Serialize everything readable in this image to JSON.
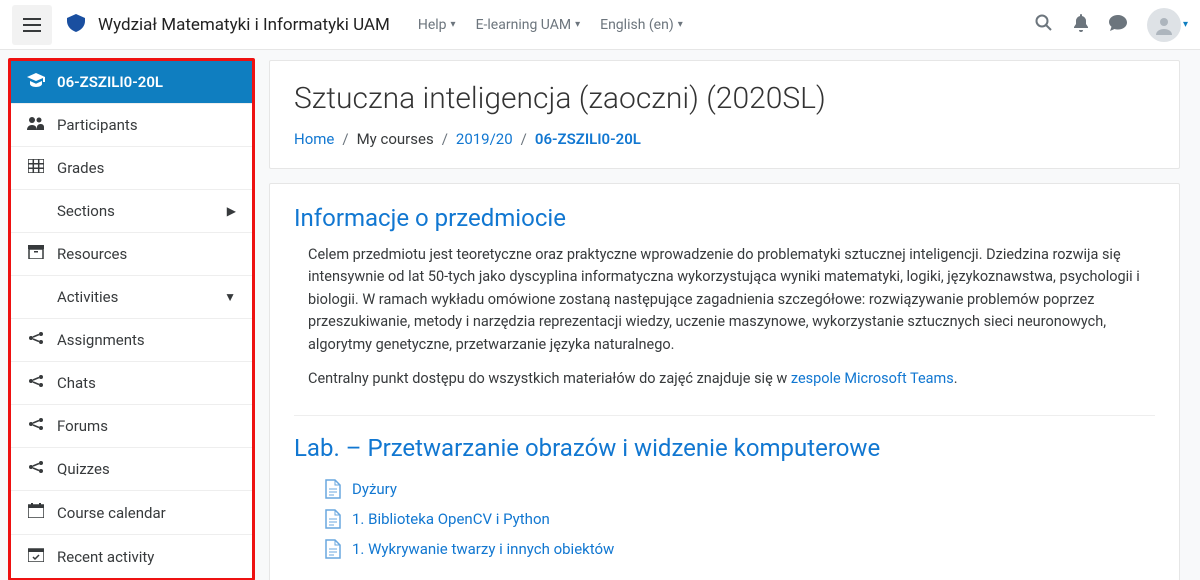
{
  "header": {
    "brand": "Wydział Matematyki i Informatyki UAM",
    "nav": [
      {
        "label": "Help"
      },
      {
        "label": "E-learning UAM"
      },
      {
        "label": "English (en)"
      }
    ]
  },
  "sidebar": {
    "items": [
      {
        "label": "06-ZSZILI0-20L",
        "icon": "graduation-cap-icon",
        "active": true
      },
      {
        "label": "Participants",
        "icon": "users-icon"
      },
      {
        "label": "Grades",
        "icon": "grid-icon"
      },
      {
        "label": "Sections",
        "icon": "",
        "chev": "▶"
      },
      {
        "label": "Resources",
        "icon": "archive-icon"
      },
      {
        "label": "Activities",
        "icon": "",
        "chev": "▼"
      },
      {
        "label": "Assignments",
        "icon": "share-icon"
      },
      {
        "label": "Chats",
        "icon": "share-icon"
      },
      {
        "label": "Forums",
        "icon": "share-icon"
      },
      {
        "label": "Quizzes",
        "icon": "share-icon"
      },
      {
        "label": "Course calendar",
        "icon": "calendar-icon"
      },
      {
        "label": "Recent activity",
        "icon": "calendar-check-icon"
      }
    ]
  },
  "course": {
    "title": "Sztuczna inteligencja (zaoczni) (2020SL)",
    "breadcrumb": {
      "home": "Home",
      "mycourses": "My courses",
      "year": "2019/20",
      "code": "06-ZSZILI0-20L"
    }
  },
  "section_info": {
    "title": "Informacje o przedmiocie",
    "para1": "Celem przedmiotu jest teoretyczne oraz praktyczne wprowadzenie do problematyki sztucznej inteligencji. Dziedzina rozwija się intensywnie od lat 50-tych jako dyscyplina informatyczna wykorzystująca wyniki matematyki, logiki, językoznawstwa, psychologii i biologii. W ramach wykładu omówione zostaną następujące zagadnienia szczegółowe: rozwiązywanie problemów poprzez przeszukiwanie, metody i narzędzia reprezentacji wiedzy, uczenie maszynowe, wykorzystanie sztucznych sieci neuronowych, algorytmy genetyczne, przetwarzanie języka naturalnego.",
    "para2_pre": "Centralny punkt dostępu do wszystkich materiałów do zajęć znajduje się w ",
    "para2_link": "zespole Microsoft Teams",
    "para2_post": "."
  },
  "section_lab": {
    "title": "Lab. – Przetwarzanie obrazów i widzenie komputerowe",
    "activities": [
      {
        "label": "Dyżury"
      },
      {
        "label": "1. Biblioteka OpenCV i Python"
      },
      {
        "label": "1. Wykrywanie twarzy i innych obiektów"
      }
    ]
  }
}
